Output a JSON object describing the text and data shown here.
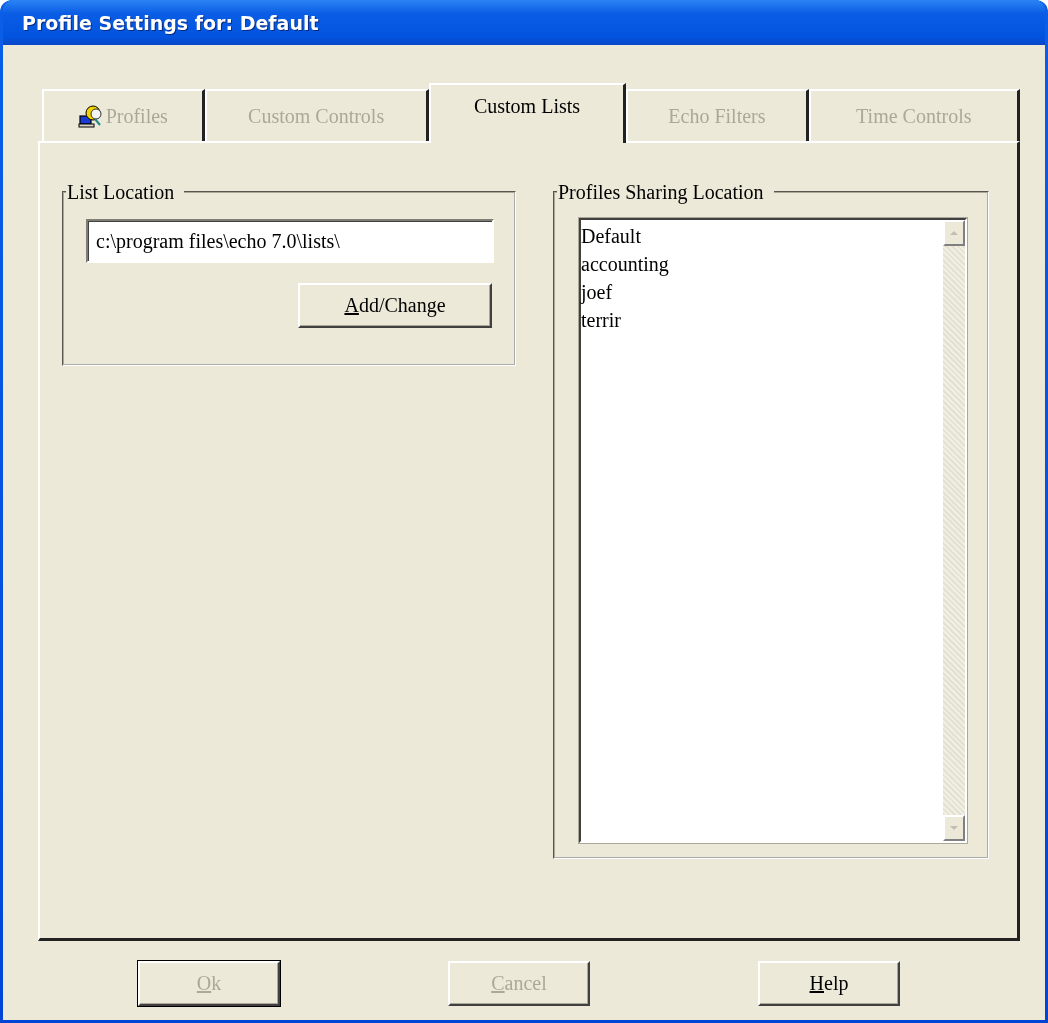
{
  "window": {
    "title": "Profile Settings for: Default"
  },
  "tabs": [
    {
      "label": "Profiles",
      "selected": false,
      "disabled": true,
      "kind": "icon"
    },
    {
      "label": "Custom Controls",
      "selected": false,
      "disabled": true,
      "kind": "plain"
    },
    {
      "label": "Custom Lists",
      "selected": true,
      "disabled": false,
      "kind": "plain"
    },
    {
      "label": "Echo Filters",
      "selected": false,
      "disabled": true,
      "kind": "plain"
    },
    {
      "label": "Time Controls",
      "selected": false,
      "disabled": true,
      "kind": "plain"
    }
  ],
  "list_location": {
    "title": "List Location",
    "value": "c:\\program files\\echo 7.0\\lists\\",
    "button": {
      "label": "Add/Change",
      "disabled": false,
      "mnemonic_first": true
    }
  },
  "profiles_sharing": {
    "title": "Profiles Sharing Location",
    "items": [
      "Default",
      "accounting",
      "joef",
      "terrir"
    ]
  },
  "buttons": [
    {
      "label": "Ok",
      "disabled": true,
      "default": true,
      "mnemonic_first": true
    },
    {
      "label": "Cancel",
      "disabled": true,
      "default": false,
      "mnemonic_first": true
    },
    {
      "label": "Help",
      "disabled": false,
      "default": false,
      "mnemonic_first": true
    }
  ]
}
